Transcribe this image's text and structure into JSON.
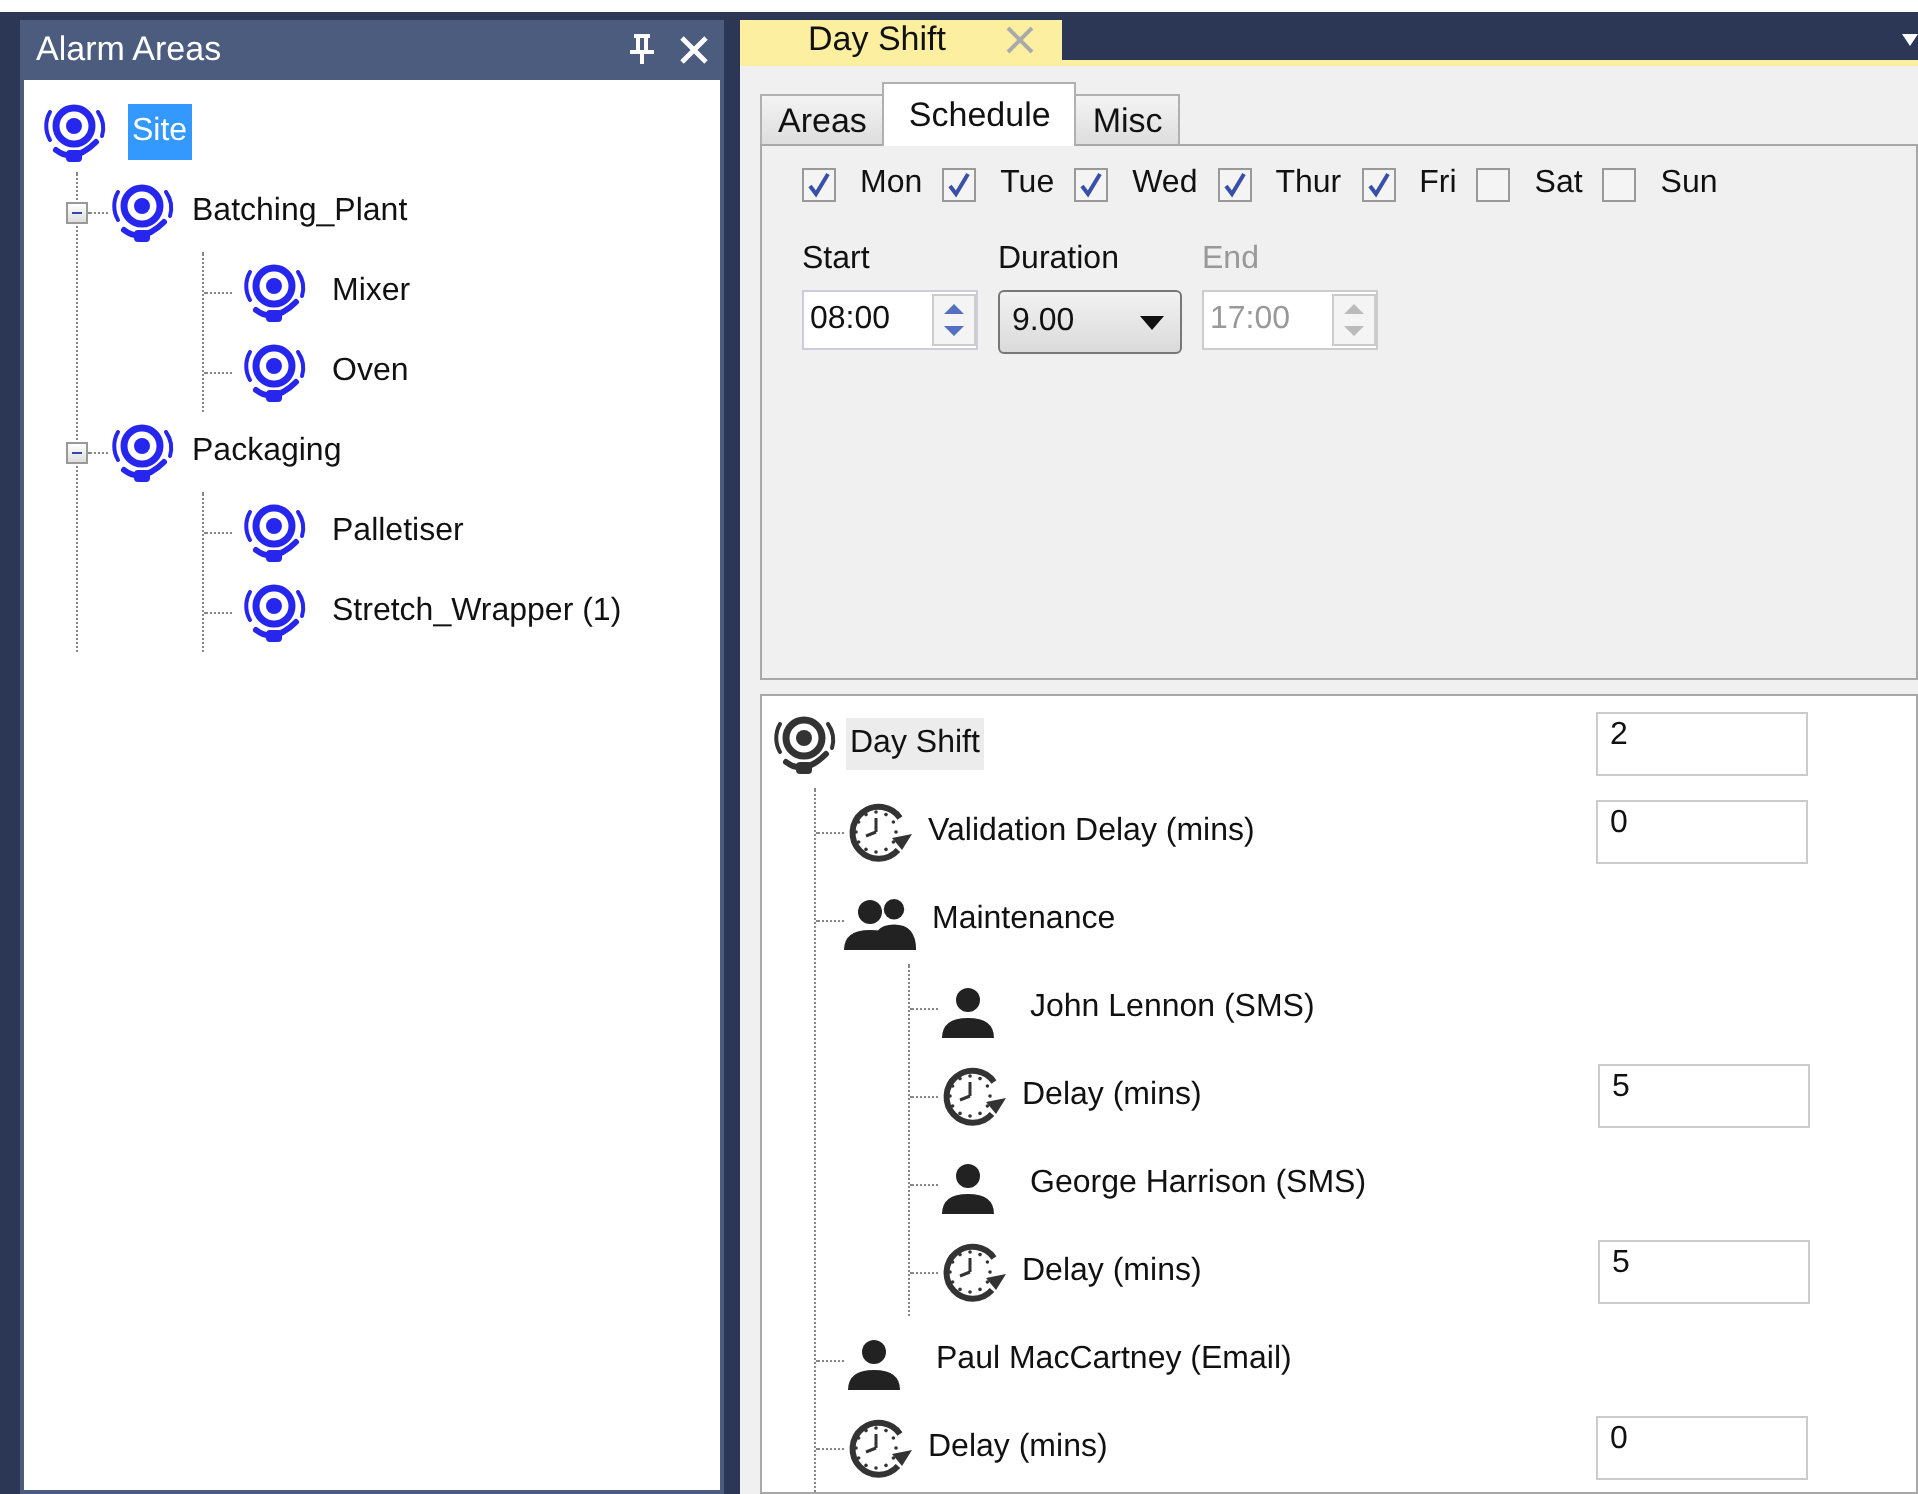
{
  "areas_panel": {
    "title": "Alarm Areas",
    "tree": [
      {
        "label": "Site",
        "selected": true,
        "children": [
          {
            "label": "Batching_Plant",
            "selected": false,
            "expanded": true,
            "children": [
              {
                "label": "Mixer",
                "selected": false
              },
              {
                "label": "Oven",
                "selected": false
              }
            ]
          },
          {
            "label": "Packaging",
            "selected": false,
            "expanded": true,
            "children": [
              {
                "label": "Palletiser",
                "selected": false
              },
              {
                "label": "Stretch_Wrapper (1)",
                "selected": false
              }
            ]
          }
        ]
      }
    ]
  },
  "document_tab": {
    "title": "Day Shift"
  },
  "tabs": [
    {
      "label": "Areas",
      "selected": false
    },
    {
      "label": "Schedule",
      "selected": true
    },
    {
      "label": "Misc",
      "selected": false
    }
  ],
  "days": [
    {
      "label": "Mon",
      "checked": true
    },
    {
      "label": "Tue",
      "checked": true
    },
    {
      "label": "Wed",
      "checked": true
    },
    {
      "label": "Thur",
      "checked": true
    },
    {
      "label": "Fri",
      "checked": true
    },
    {
      "label": "Sat",
      "checked": false
    },
    {
      "label": "Sun",
      "checked": false
    }
  ],
  "times": [
    {
      "kind": "spinner",
      "label": "Start",
      "value": "08:00",
      "disabled": false
    },
    {
      "kind": "dropdown",
      "label": "Duration",
      "value": "9.00",
      "disabled": false
    },
    {
      "kind": "spinner",
      "label": "End",
      "value": "17:00",
      "disabled": true
    }
  ],
  "escalation_tree": [
    {
      "kind": "alarm",
      "label": "Day Shift",
      "value": "2",
      "children": [
        {
          "kind": "delay",
          "label": "Validation Delay (mins)",
          "value": "0"
        },
        {
          "kind": "group",
          "label": "Maintenance",
          "children": [
            {
              "kind": "person",
              "label": "John Lennon (SMS)"
            },
            {
              "kind": "delay",
              "label": "Delay (mins)",
              "value": "5"
            },
            {
              "kind": "person",
              "label": "George Harrison (SMS)"
            },
            {
              "kind": "delay",
              "label": "Delay (mins)",
              "value": "5"
            }
          ]
        },
        {
          "kind": "person",
          "label": "Paul MacCartney (Email)"
        },
        {
          "kind": "delay",
          "label": "Delay (mins)",
          "value": "0"
        }
      ]
    }
  ]
}
